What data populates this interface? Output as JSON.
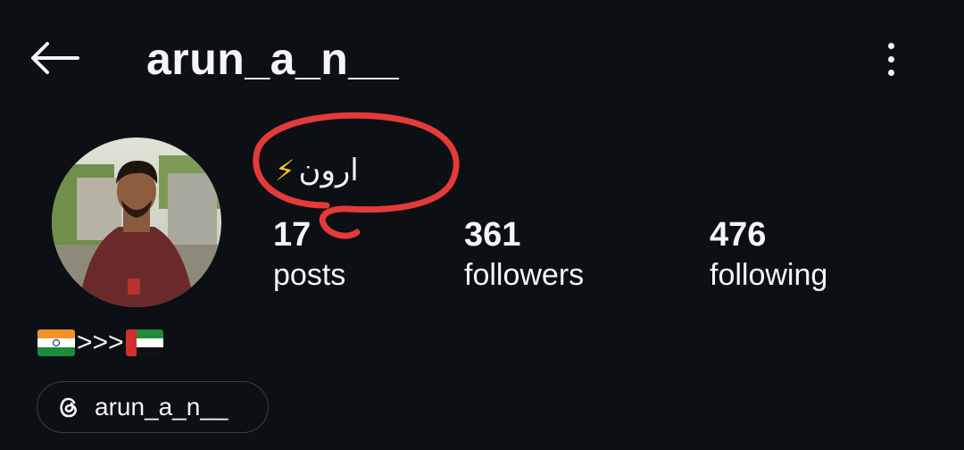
{
  "header": {
    "username": "arun_a_n__",
    "back_icon": "arrow-left-icon",
    "menu_icon": "more-vertical-icon"
  },
  "profile": {
    "display_name": "ارون",
    "display_name_icon": "lightning-bolt-emoji",
    "avatar": "profile-photo"
  },
  "stats": [
    {
      "count": "17",
      "label": "posts"
    },
    {
      "count": "361",
      "label": "followers"
    },
    {
      "count": "476",
      "label": "following"
    }
  ],
  "bio": {
    "text": ">>>",
    "leading_icon": "india-flag-emoji",
    "trailing_icon": "uae-flag-emoji"
  },
  "threads_link": {
    "label": "arun_a_n__",
    "icon": "threads-icon"
  },
  "colors": {
    "background": "#0c0f14",
    "text": "#f5f5f5",
    "annotation_red": "#e43a3a",
    "chip_border": "#3a3d44"
  }
}
